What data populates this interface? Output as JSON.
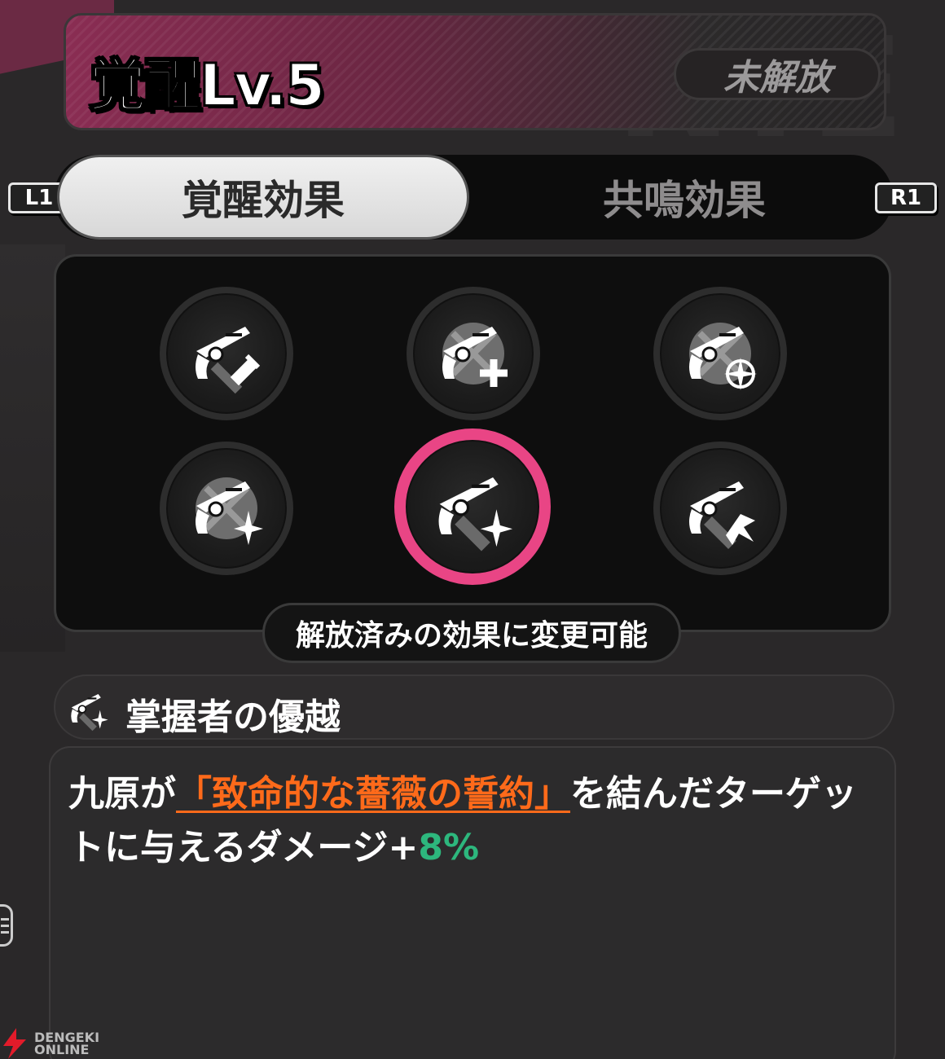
{
  "header": {
    "title": "覚醒Lv.5",
    "status": "未解放"
  },
  "tabs": [
    {
      "label": "覚醒効果",
      "active": true
    },
    {
      "label": "共鳴効果",
      "active": false
    }
  ],
  "key_hints": {
    "left": "L1",
    "right": "R1"
  },
  "effects": {
    "slots": [
      {
        "icon": "revolver-sword-icon",
        "selected": false
      },
      {
        "icon": "revolver-shield-plus-icon",
        "selected": false
      },
      {
        "icon": "revolver-shield-compass-icon",
        "selected": false
      },
      {
        "icon": "revolver-shield-star-icon",
        "selected": false
      },
      {
        "icon": "revolver-star-icon",
        "selected": true
      },
      {
        "icon": "revolver-burst-icon",
        "selected": false
      }
    ],
    "caption": "解放済みの効果に変更可能",
    "selected_color": "#e94585"
  },
  "skill": {
    "icon": "revolver-star-icon",
    "name": "掌握者の優越"
  },
  "description": {
    "prefix": "九原が",
    "keyword": "「致命的な薔薇の誓約」",
    "middle": "を結んだターゲットに与えるダメージ+",
    "value": "8%",
    "keyword_color": "#ff6a1a",
    "value_color": "#2db77d"
  },
  "watermark": {
    "line1": "DENGEKI",
    "line2": "ONLINE"
  }
}
